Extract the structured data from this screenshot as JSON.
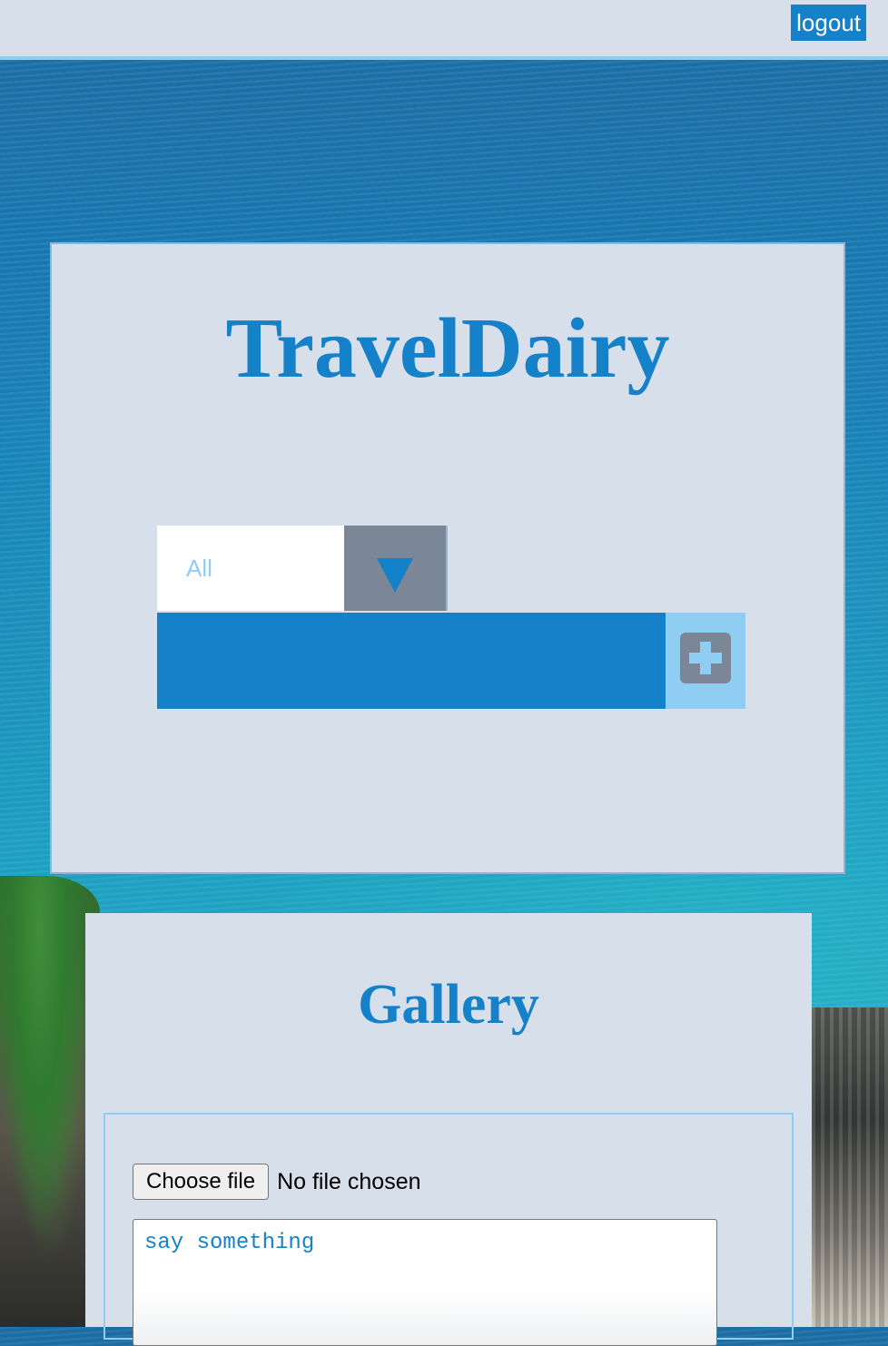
{
  "header": {
    "logout_label": "logout"
  },
  "main": {
    "title": "TravelDairy",
    "filter": {
      "selected": "All"
    },
    "new_entry": {
      "value": ""
    }
  },
  "gallery": {
    "title": "Gallery",
    "file_button_label": "Choose file",
    "file_status": "No file chosen",
    "caption_placeholder": "say something"
  },
  "colors": {
    "accent": "#1581c9",
    "light_accent": "#8fcdf3",
    "panel": "#d6dfea",
    "muted": "#7b8796"
  },
  "icons": {
    "dropdown": "triangle-down-icon",
    "add": "plus-icon"
  }
}
